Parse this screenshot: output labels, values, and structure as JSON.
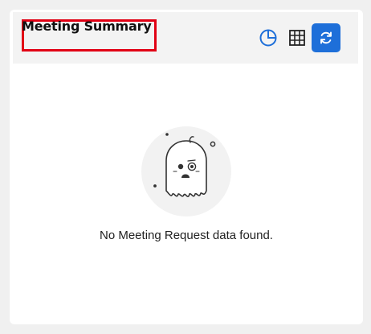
{
  "widget": {
    "title": "Meeting Summary",
    "actions": [
      {
        "name": "pie-chart-view",
        "icon": "pie-chart-icon"
      },
      {
        "name": "table-view",
        "icon": "grid-icon"
      },
      {
        "name": "refresh",
        "icon": "refresh-icon"
      }
    ],
    "empty_state": {
      "illustration": "sad-ghost-icon",
      "message": "No Meeting Request data found."
    }
  },
  "colors": {
    "accent": "#1e6fd9",
    "highlight_border": "#e10014",
    "header_bg": "#f3f3f3",
    "page_bg": "#f0f0f0"
  }
}
